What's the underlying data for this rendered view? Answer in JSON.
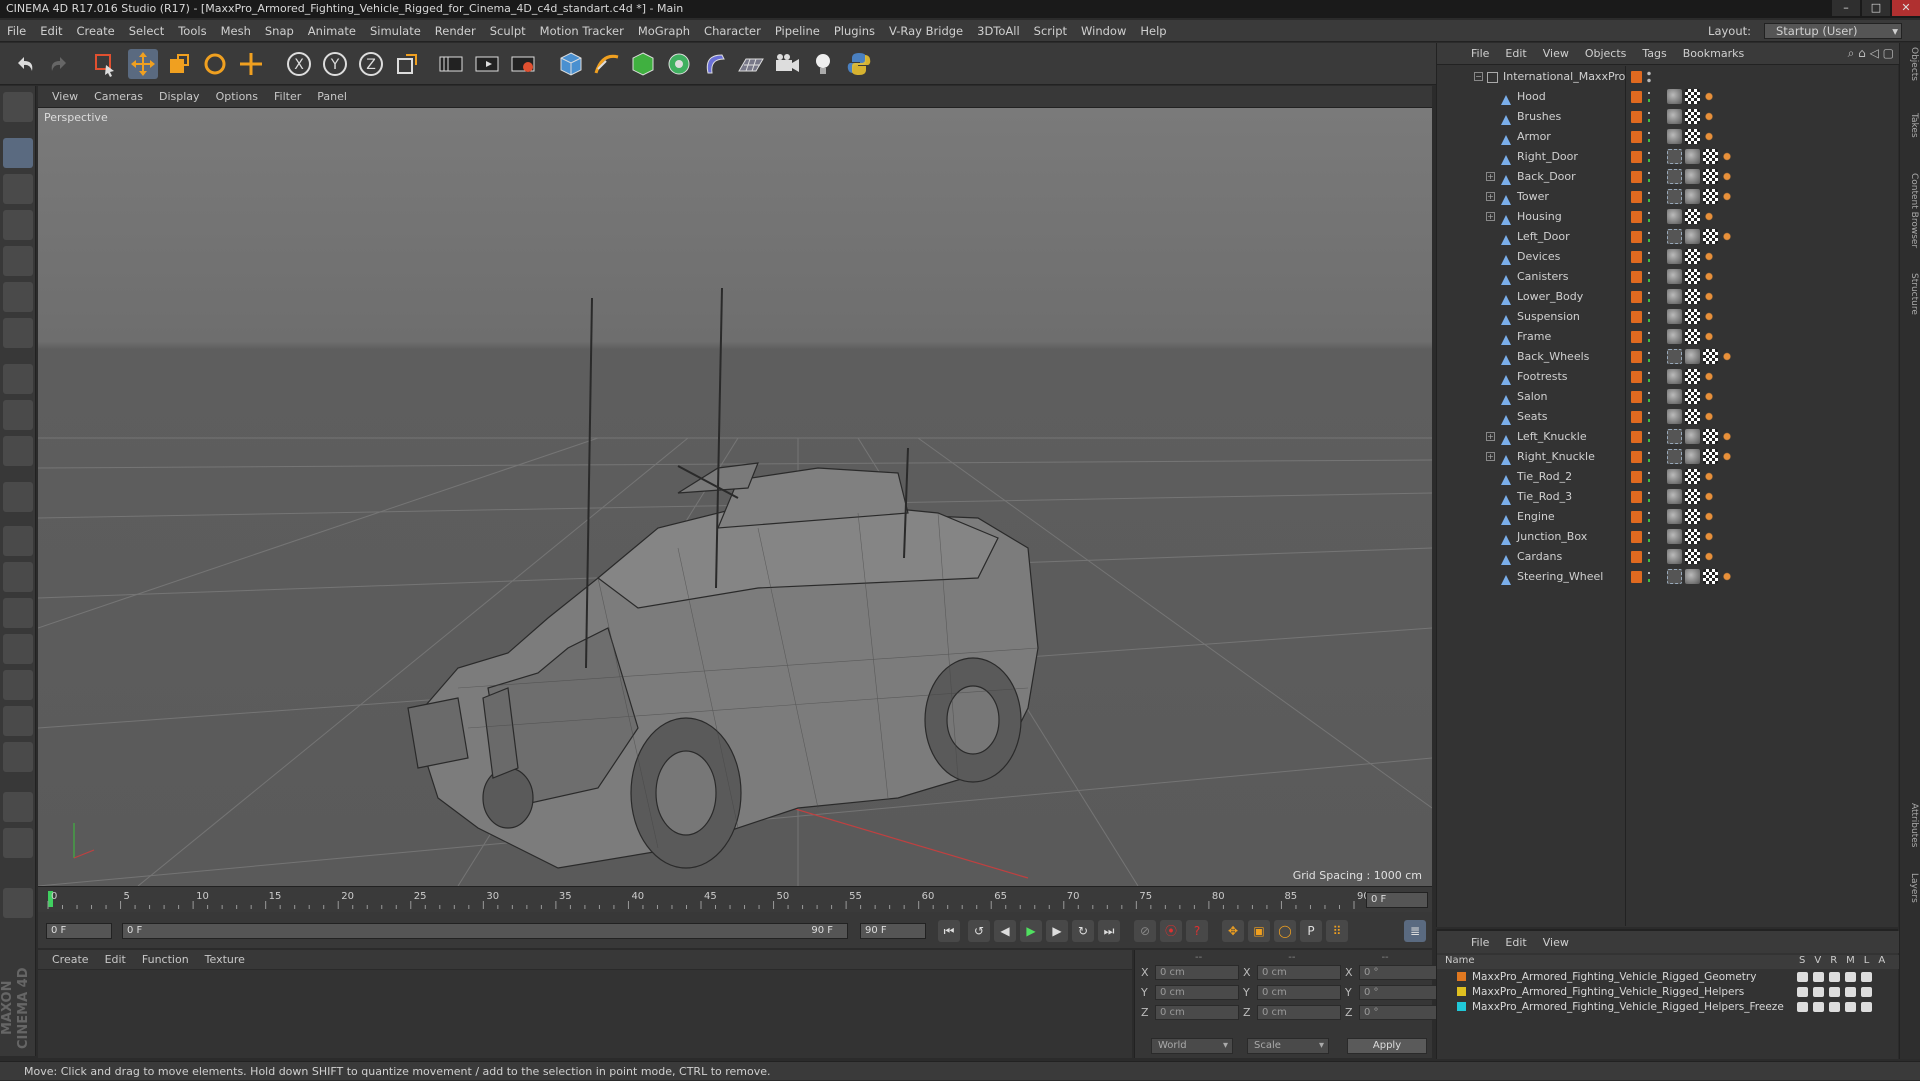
{
  "window": {
    "title": "CINEMA 4D R17.016 Studio (R17) - [MaxxPro_Armored_Fighting_Vehicle_Rigged_for_Cinema_4D_c4d_standart.c4d *] - Main"
  },
  "menu": {
    "items": [
      "File",
      "Edit",
      "Create",
      "Select",
      "Tools",
      "Mesh",
      "Snap",
      "Animate",
      "Simulate",
      "Render",
      "Sculpt",
      "Motion Tracker",
      "MoGraph",
      "Character",
      "Pipeline",
      "Plugins",
      "V-Ray Bridge",
      "3DToAll",
      "Script",
      "Window",
      "Help"
    ],
    "layout_label": "Layout:",
    "layout_value": "Startup (User)"
  },
  "viewport": {
    "menu": [
      "View",
      "Cameras",
      "Display",
      "Options",
      "Filter",
      "Panel"
    ],
    "camera_label": "Perspective",
    "grid_spacing": "Grid Spacing : 1000 cm"
  },
  "timeline": {
    "ticks": [
      "0",
      "5",
      "10",
      "15",
      "20",
      "25",
      "30",
      "35",
      "40",
      "45",
      "50",
      "55",
      "60",
      "65",
      "70",
      "75",
      "80",
      "85",
      "90"
    ],
    "frame_end_field": "0 F",
    "start_field": "0 F",
    "range_start": "0 F",
    "range_end": "90 F",
    "end_field": "90 F"
  },
  "material_panel": {
    "menu": [
      "Create",
      "Edit",
      "Function",
      "Texture"
    ]
  },
  "coordinates": {
    "rows": [
      {
        "a": "X",
        "av": "0 cm",
        "b": "X",
        "bv": "0 cm",
        "c": "X",
        "cv": "0 °"
      },
      {
        "a": "Y",
        "av": "0 cm",
        "b": "Y",
        "bv": "0 cm",
        "c": "Y",
        "cv": "0 °"
      },
      {
        "a": "Z",
        "av": "0 cm",
        "b": "Z",
        "bv": "0 cm",
        "c": "Z",
        "cv": "0 °"
      }
    ],
    "world": "World",
    "scale": "Scale",
    "apply": "Apply",
    "dashes": [
      "--",
      "--",
      "--"
    ]
  },
  "status": {
    "text": "Move: Click and drag to move elements. Hold down SHIFT to quantize movement / add to the selection in point mode, CTRL to remove."
  },
  "object_panel": {
    "menu": [
      "File",
      "Edit",
      "View",
      "Objects",
      "Tags",
      "Bookmarks"
    ],
    "root": "International_MaxxPro",
    "objects": [
      {
        "name": "Hood",
        "exp": false,
        "tags": "m"
      },
      {
        "name": "Brushes",
        "exp": false,
        "tags": "m"
      },
      {
        "name": "Armor",
        "exp": false,
        "tags": "m"
      },
      {
        "name": "Right_Door",
        "exp": false,
        "tags": "s"
      },
      {
        "name": "Back_Door",
        "exp": true,
        "tags": "s"
      },
      {
        "name": "Tower",
        "exp": true,
        "tags": "s"
      },
      {
        "name": "Housing",
        "exp": true,
        "tags": "m"
      },
      {
        "name": "Left_Door",
        "exp": false,
        "tags": "s"
      },
      {
        "name": "Devices",
        "exp": false,
        "tags": "m"
      },
      {
        "name": "Canisters",
        "exp": false,
        "tags": "m"
      },
      {
        "name": "Lower_Body",
        "exp": false,
        "tags": "m"
      },
      {
        "name": "Suspension",
        "exp": false,
        "tags": "m"
      },
      {
        "name": "Frame",
        "exp": false,
        "tags": "m"
      },
      {
        "name": "Back_Wheels",
        "exp": false,
        "tags": "s"
      },
      {
        "name": "Footrests",
        "exp": false,
        "tags": "m"
      },
      {
        "name": "Salon",
        "exp": false,
        "tags": "m"
      },
      {
        "name": "Seats",
        "exp": false,
        "tags": "m"
      },
      {
        "name": "Left_Knuckle",
        "exp": true,
        "tags": "s"
      },
      {
        "name": "Right_Knuckle",
        "exp": true,
        "tags": "s"
      },
      {
        "name": "Tie_Rod_2",
        "exp": false,
        "tags": "m"
      },
      {
        "name": "Tie_Rod_3",
        "exp": false,
        "tags": "m"
      },
      {
        "name": "Engine",
        "exp": false,
        "tags": "m"
      },
      {
        "name": "Junction_Box",
        "exp": false,
        "tags": "m"
      },
      {
        "name": "Cardans",
        "exp": false,
        "tags": "m"
      },
      {
        "name": "Steering_Wheel",
        "exp": false,
        "tags": "s"
      }
    ]
  },
  "layer_panel": {
    "menu": [
      "File",
      "Edit",
      "View"
    ],
    "header_name": "Name",
    "header_cols": [
      "S",
      "V",
      "R",
      "M",
      "L",
      "A"
    ],
    "layers": [
      {
        "name": "MaxxPro_Armored_Fighting_Vehicle_Rigged_Geometry",
        "color": "#e07820"
      },
      {
        "name": "MaxxPro_Armored_Fighting_Vehicle_Rigged_Helpers",
        "color": "#e0c020"
      },
      {
        "name": "MaxxPro_Armored_Fighting_Vehicle_Rigged_Helpers_Freeze",
        "color": "#20c8d8"
      }
    ]
  },
  "side_tabs": [
    "Objects",
    "Takes",
    "Content Browser",
    "Structure",
    "Attributes",
    "Layers"
  ],
  "brand": "MAXON CINEMA 4D"
}
